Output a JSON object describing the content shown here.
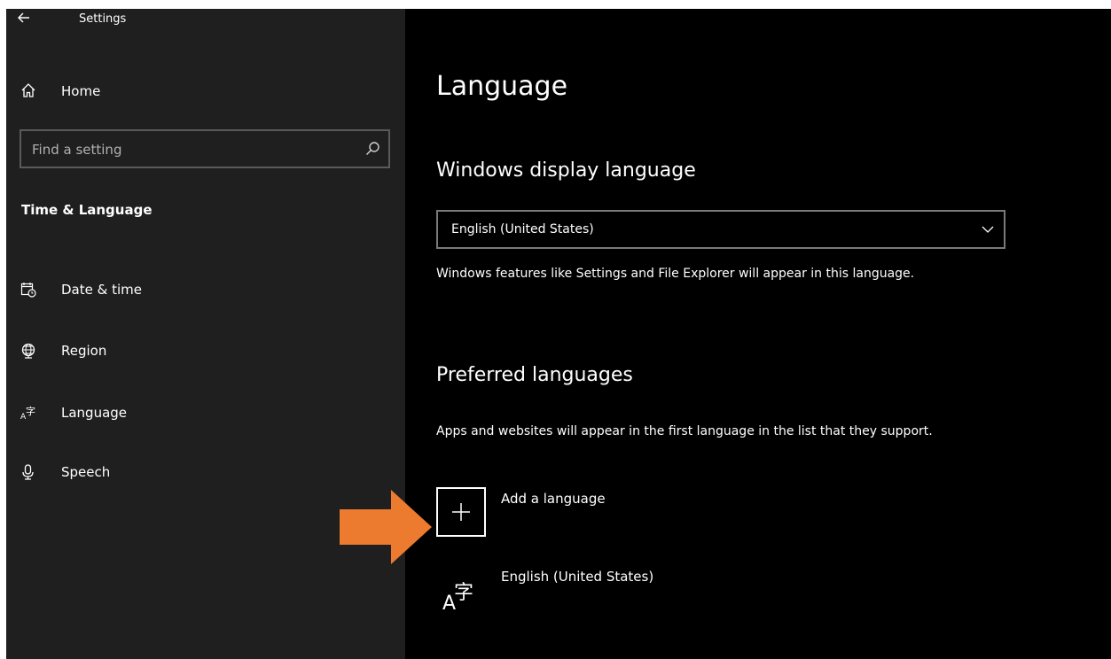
{
  "window": {
    "title": "Settings"
  },
  "sidebar": {
    "home_label": "Home",
    "search_placeholder": "Find a setting",
    "section_title": "Time & Language",
    "items": [
      {
        "label": "Date & time",
        "icon": "calendar-clock-icon"
      },
      {
        "label": "Region",
        "icon": "globe-icon"
      },
      {
        "label": "Language",
        "icon": "language-icon"
      },
      {
        "label": "Speech",
        "icon": "microphone-icon"
      }
    ]
  },
  "main": {
    "title": "Language",
    "display_language": {
      "heading": "Windows display language",
      "selected": "English (United States)",
      "description": "Windows features like Settings and File Explorer will appear in this language."
    },
    "preferred": {
      "heading": "Preferred languages",
      "description": "Apps and websites will appear in the first language in the list that they support.",
      "add_label": "Add a language",
      "languages": [
        {
          "label": "English (United States)"
        }
      ]
    }
  },
  "colors": {
    "sidebar_bg": "#1f1f1f",
    "main_bg": "#000000",
    "annotation_arrow": "#ec7a2f"
  }
}
